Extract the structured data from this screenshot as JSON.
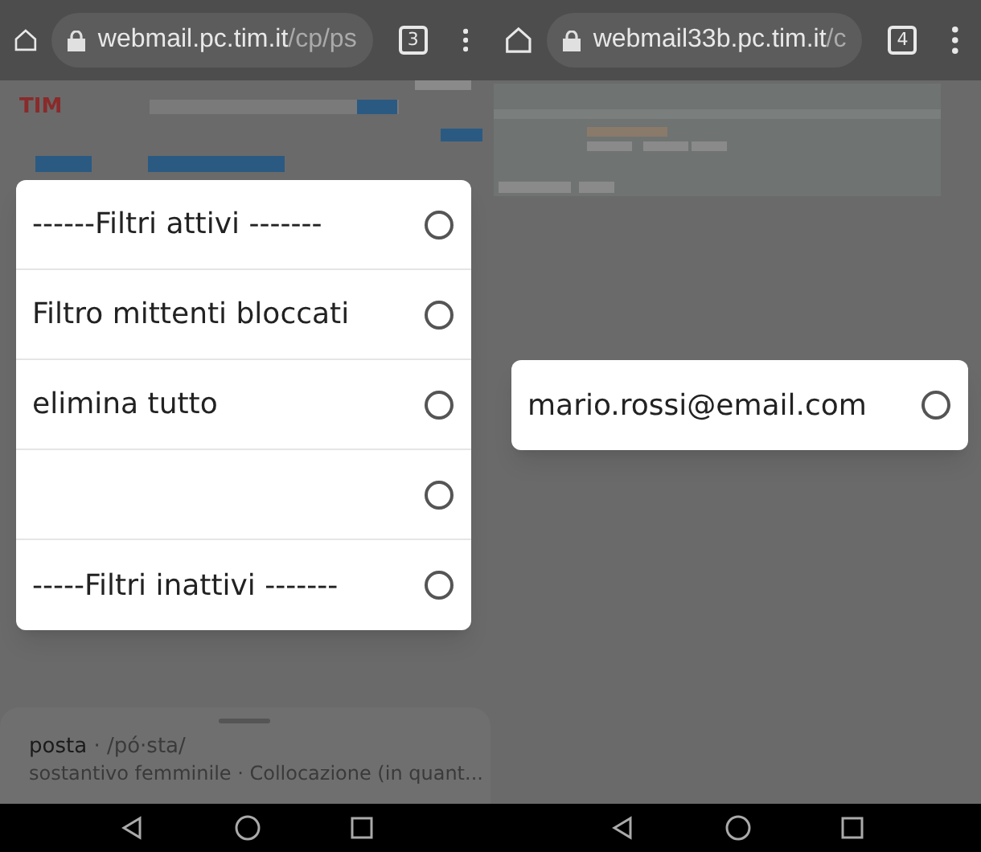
{
  "panes": [
    {
      "browser": {
        "url_host": "webmail.pc.tim.it",
        "url_path": "/cp/ps",
        "tab_count": "3"
      },
      "page": {
        "logo": "TIM"
      },
      "dialog": {
        "options": [
          {
            "label": "------Filtri attivi -------",
            "selected": false
          },
          {
            "label": "Filtro mittenti bloccati",
            "selected": false
          },
          {
            "label": "elimina tutto",
            "selected": false
          },
          {
            "selected": false
          },
          {
            "label": "-----Filtri inattivi -------",
            "selected": false
          }
        ]
      },
      "bottom_sheet": {
        "word": "posta",
        "pronunciation": "· /pó·sta/",
        "definition": "sostantivo femminile · Collocazione (in quant..."
      }
    },
    {
      "browser": {
        "url_host": "webmail33b.pc.tim.it",
        "url_path": "/c",
        "tab_count": "4"
      },
      "dialog": {
        "options": [
          {
            "label": "mario.rossi@email.com",
            "selected": false
          }
        ]
      }
    }
  ]
}
